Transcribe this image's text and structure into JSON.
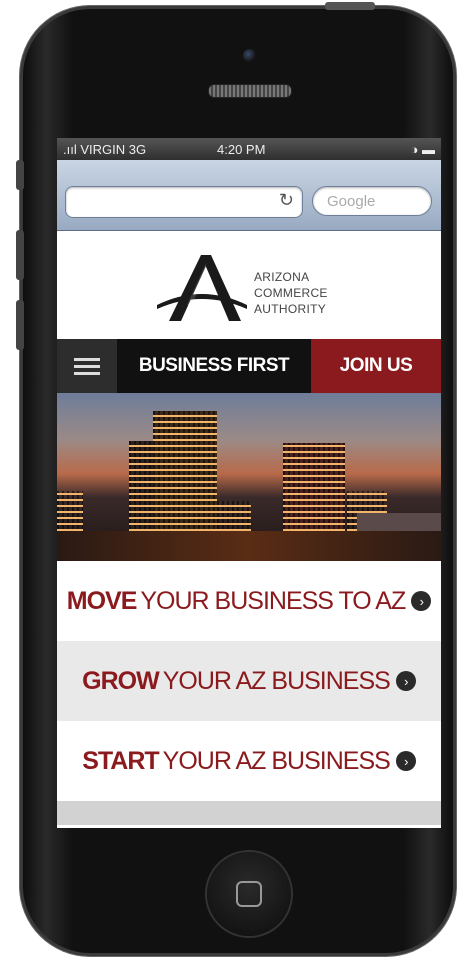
{
  "status_bar": {
    "carrier": ".ııl VIRGIN  3G",
    "time": "4:20 PM",
    "icons": "◑ ▬"
  },
  "browser": {
    "reload_icon": "↻",
    "search_placeholder": "Google"
  },
  "logo": {
    "line1": "ARIZONA",
    "line2": "COMMERCE",
    "line3": "AUTHORITY"
  },
  "nav": {
    "business_first": "BUSINESS FIRST",
    "join_us": "JOIN US"
  },
  "links": [
    {
      "bold": "MOVE",
      "rest": "YOUR BUSINESS TO AZ",
      "arrow": "›"
    },
    {
      "bold": "GROW",
      "rest": "YOUR AZ BUSINESS",
      "arrow": "›"
    },
    {
      "bold": "START",
      "rest": "YOUR AZ BUSINESS",
      "arrow": "›"
    }
  ],
  "colors": {
    "accent": "#8b1a1e",
    "nav_dark": "#111111"
  }
}
